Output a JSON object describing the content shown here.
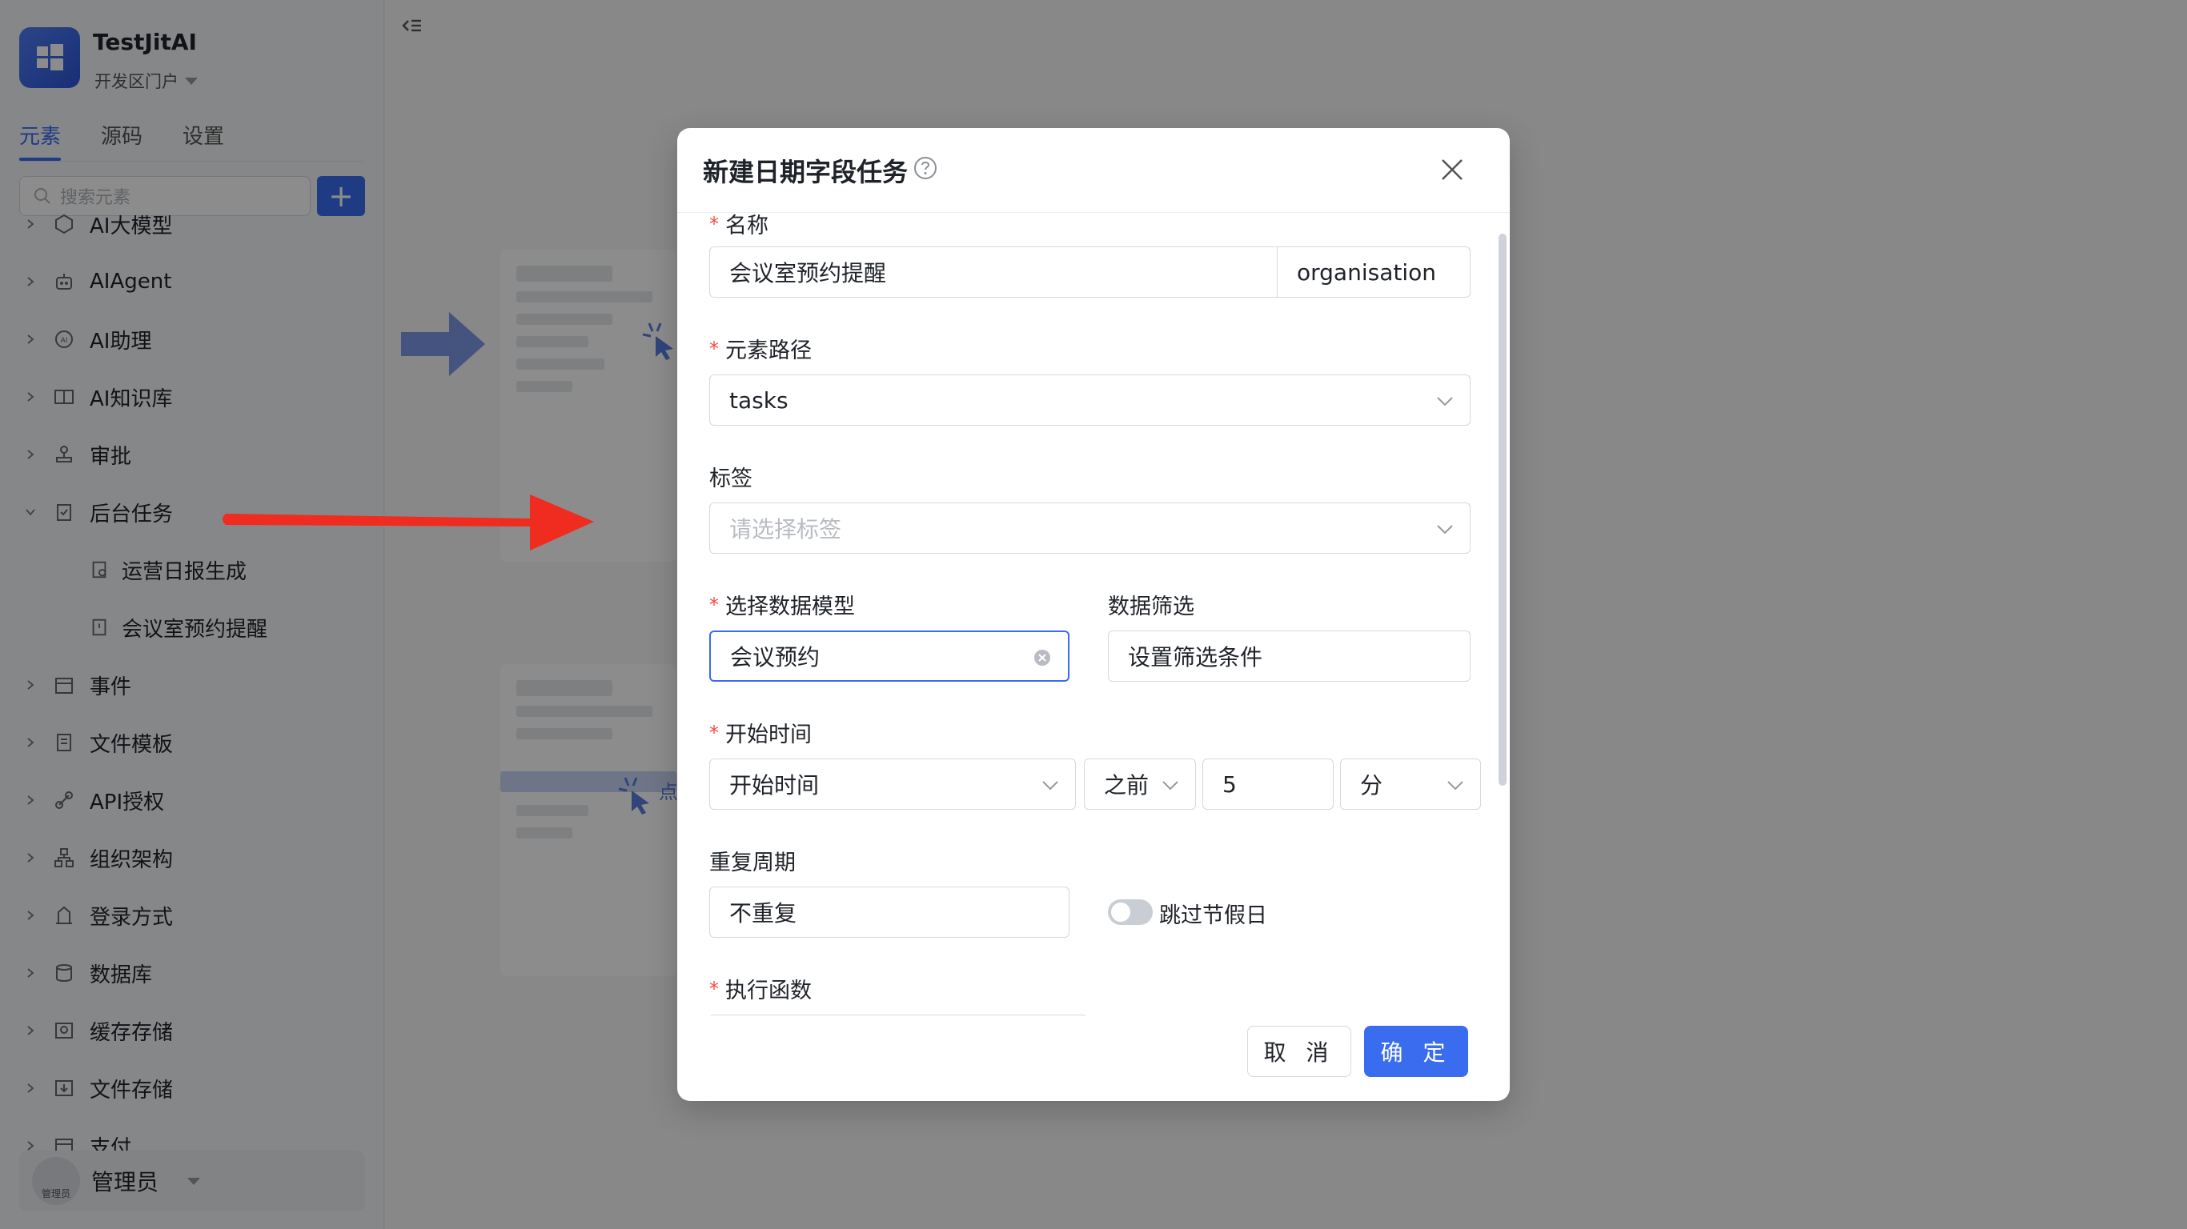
{
  "sidebar": {
    "app_name": "TestJitAI",
    "portal": "开发区门户",
    "tabs": [
      {
        "label": "元素",
        "active": true
      },
      {
        "label": "源码",
        "active": false
      },
      {
        "label": "设置",
        "active": false
      }
    ],
    "search_placeholder": "搜索元素",
    "add_label": "+",
    "items": [
      {
        "label": "AI大模型",
        "icon": "ai-model-icon",
        "expanded": false
      },
      {
        "label": "AIAgent",
        "icon": "robot-icon",
        "expanded": false
      },
      {
        "label": "AI助理",
        "icon": "ai-assistant-icon",
        "expanded": false
      },
      {
        "label": "AI知识库",
        "icon": "book-icon",
        "expanded": false
      },
      {
        "label": "审批",
        "icon": "stamp-icon",
        "expanded": false
      },
      {
        "label": "后台任务",
        "icon": "task-icon",
        "expanded": true
      },
      {
        "label": "运营日报生成",
        "icon": "report-icon",
        "child": true
      },
      {
        "label": "会议室预约提醒",
        "icon": "clock-doc-icon",
        "child": true
      },
      {
        "label": "事件",
        "icon": "calendar-icon",
        "expanded": false
      },
      {
        "label": "文件模板",
        "icon": "file-template-icon",
        "expanded": false
      },
      {
        "label": "API授权",
        "icon": "link-icon",
        "expanded": false
      },
      {
        "label": "组织架构",
        "icon": "org-chart-icon",
        "expanded": false
      },
      {
        "label": "登录方式",
        "icon": "login-icon",
        "expanded": false
      },
      {
        "label": "数据库",
        "icon": "database-icon",
        "expanded": false
      },
      {
        "label": "缓存存储",
        "icon": "cache-icon",
        "expanded": false
      },
      {
        "label": "文件存储",
        "icon": "file-storage-icon",
        "expanded": false
      },
      {
        "label": "支付",
        "icon": "payment-icon",
        "expanded": false
      }
    ],
    "user": {
      "name": "管理员",
      "avatar_text": "管理员"
    }
  },
  "background_cards": {
    "hint_char": "点"
  },
  "modal": {
    "title": "新建日期字段任务",
    "fields": {
      "name": {
        "label": "名称",
        "required": true,
        "value": "会议室预约提醒",
        "suffix": "organisation"
      },
      "path": {
        "label": "元素路径",
        "required": true,
        "value": "tasks"
      },
      "tags": {
        "label": "标签",
        "required": false,
        "placeholder": "请选择标签"
      },
      "model": {
        "label": "选择数据模型",
        "required": true,
        "value": "会议预约"
      },
      "filter": {
        "label": "数据筛选",
        "required": false,
        "value": "设置筛选条件"
      },
      "start_time": {
        "label": "开始时间",
        "required": true,
        "field": "开始时间",
        "direction": "之前",
        "amount": "5",
        "unit": "分"
      },
      "repeat": {
        "label": "重复周期",
        "required": false,
        "value": "不重复"
      },
      "skip_holiday": {
        "label": "跳过节假日",
        "enabled": false
      },
      "function": {
        "label": "执行函数",
        "required": true
      }
    },
    "buttons": {
      "cancel": "取 消",
      "ok": "确 定"
    }
  },
  "colors": {
    "primary": "#3a6cf0",
    "required": "#f54a45",
    "annotation_arrow": "#f02b20"
  }
}
